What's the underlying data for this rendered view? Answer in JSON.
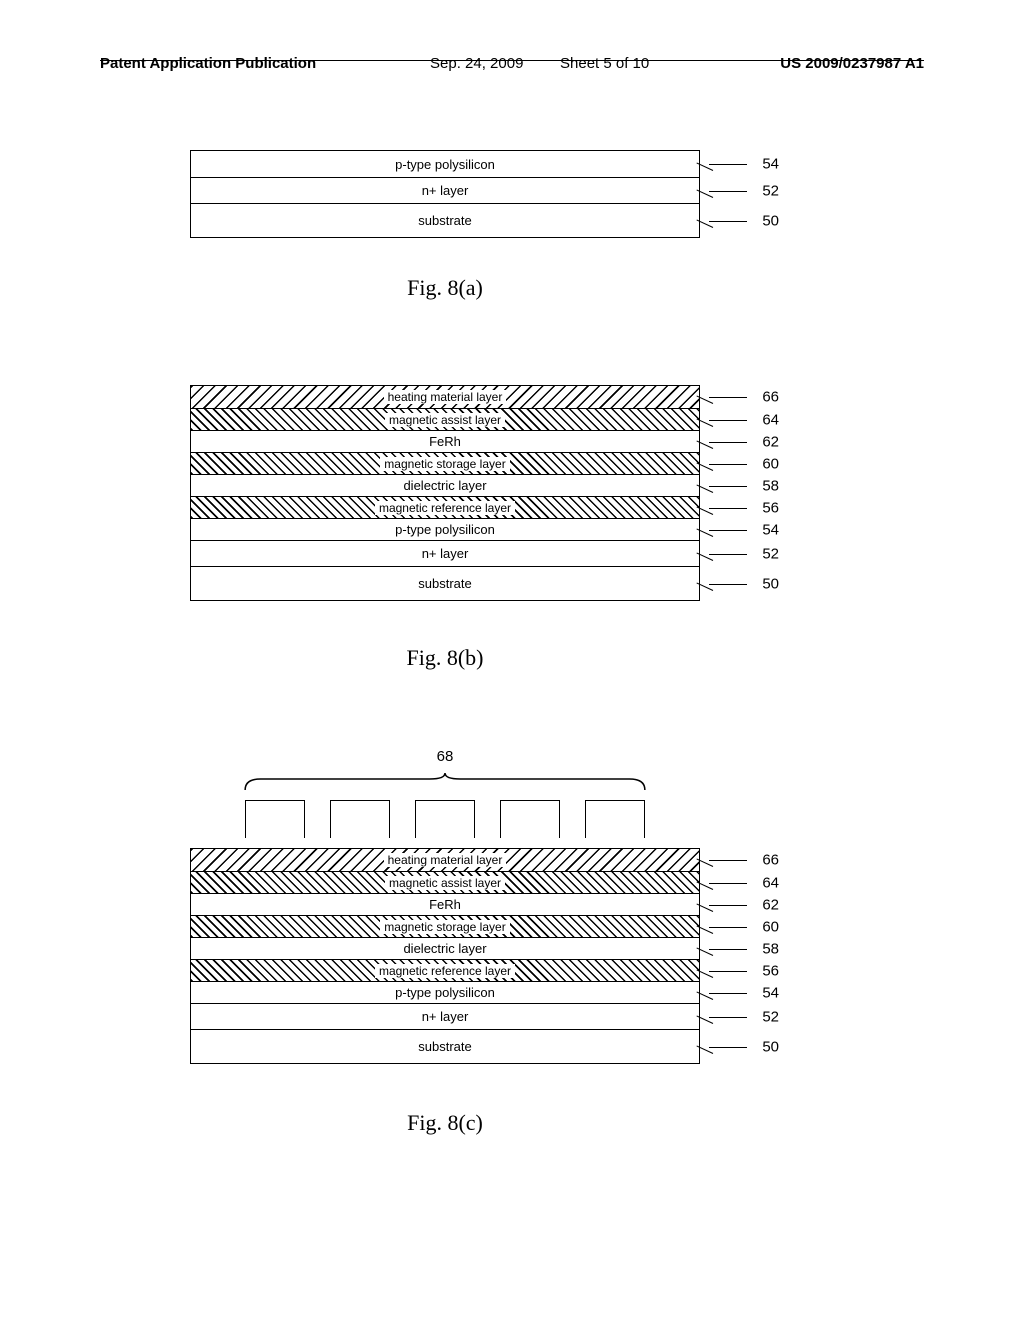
{
  "header": {
    "publication": "Patent Application Publication",
    "date": "Sep. 24, 2009",
    "sheet": "Sheet 5 of 10",
    "pubnum": "US 2009/0237987 A1"
  },
  "figures": {
    "a": {
      "caption": "Fig. 8(a)",
      "layers": [
        {
          "label": "p-type polysilicon",
          "ref": "54"
        },
        {
          "label": "n+ layer",
          "ref": "52"
        },
        {
          "label": "substrate",
          "ref": "50"
        }
      ]
    },
    "b": {
      "caption": "Fig. 8(b)",
      "layers": [
        {
          "label": "heating material layer",
          "ref": "66"
        },
        {
          "label": "magnetic assist layer",
          "ref": "64"
        },
        {
          "label": "FeRh",
          "ref": "62"
        },
        {
          "label": "magnetic storage layer",
          "ref": "60"
        },
        {
          "label": "dielectric layer",
          "ref": "58"
        },
        {
          "label": "magnetic reference layer",
          "ref": "56"
        },
        {
          "label": "p-type polysilicon",
          "ref": "54"
        },
        {
          "label": "n+ layer",
          "ref": "52"
        },
        {
          "label": "substrate",
          "ref": "50"
        }
      ]
    },
    "c": {
      "caption": "Fig. 8(c)",
      "mask_ref": "68",
      "layers": [
        {
          "label": "heating material layer",
          "ref": "66"
        },
        {
          "label": "magnetic assist layer",
          "ref": "64"
        },
        {
          "label": "FeRh",
          "ref": "62"
        },
        {
          "label": "magnetic storage layer",
          "ref": "60"
        },
        {
          "label": "dielectric layer",
          "ref": "58"
        },
        {
          "label": "magnetic reference layer",
          "ref": "56"
        },
        {
          "label": "p-type polysilicon",
          "ref": "54"
        },
        {
          "label": "n+ layer",
          "ref": "52"
        },
        {
          "label": "substrate",
          "ref": "50"
        }
      ]
    }
  }
}
